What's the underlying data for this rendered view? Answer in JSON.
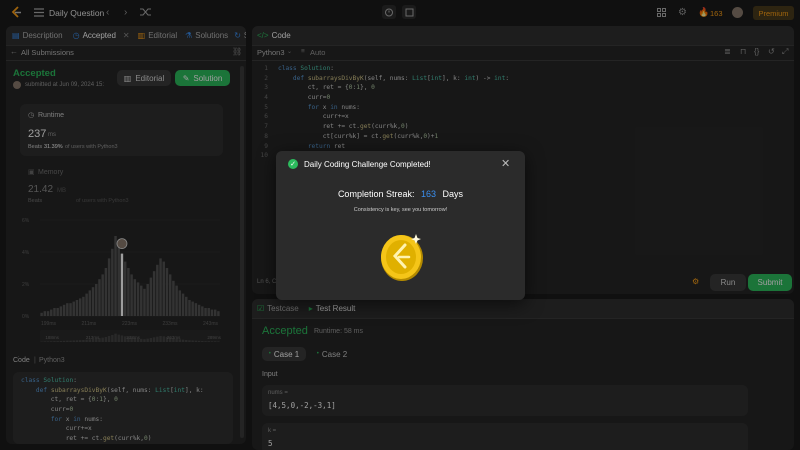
{
  "topbar": {
    "title": "Daily Question",
    "streak_count": "163",
    "premium_label": "Premium"
  },
  "left_panel": {
    "tabs": [
      "Description",
      "Accepted",
      "Editorial",
      "Solutions",
      "S"
    ],
    "back_link": "All Submissions",
    "status": "Accepted",
    "submitted_text": "submitted at Jun 09, 2024 15:",
    "editorial_button": "Editorial",
    "solution_button": "Solution",
    "runtime": {
      "label": "Runtime",
      "value": "237",
      "unit": "ms",
      "beats_label": "Beats",
      "beats_value": "31.39%",
      "beats_suffix": "of users with Python3"
    },
    "memory": {
      "label": "Memory",
      "value": "21.42",
      "unit": "MB",
      "beats_label": "Beats",
      "beats_value": "",
      "beats_suffix": "of users with Python3"
    },
    "code_label": "Code",
    "code_lang": "Python3"
  },
  "chart_data": {
    "type": "bar",
    "y_ticks": [
      "6%",
      "4%",
      "2%",
      "0%"
    ],
    "ylim": [
      0,
      6
    ],
    "x_ticks": [
      "199ms",
      "211ms",
      "223ms",
      "233ms",
      "243ms"
    ],
    "mini_x_ticks": [
      "188ms",
      "213ms",
      "238ms",
      "263ms",
      "289ms"
    ],
    "highlight_index": 25,
    "values": [
      0.2,
      0.3,
      0.3,
      0.4,
      0.5,
      0.5,
      0.6,
      0.7,
      0.8,
      0.8,
      0.9,
      1.0,
      1.1,
      1.2,
      1.4,
      1.6,
      1.8,
      2.0,
      2.3,
      2.6,
      3.0,
      3.6,
      4.2,
      5.0,
      4.4,
      3.9,
      3.4,
      3.0,
      2.6,
      2.3,
      2.1,
      1.9,
      1.7,
      2.0,
      2.4,
      2.8,
      3.2,
      3.6,
      3.4,
      3.0,
      2.6,
      2.2,
      1.9,
      1.6,
      1.4,
      1.2,
      1.0,
      0.9,
      0.8,
      0.7,
      0.6,
      0.5,
      0.5,
      0.4,
      0.4,
      0.3
    ]
  },
  "left_code": [
    "class Solution:",
    "    def subarraysDivByK(self, nums: List[int], k:",
    "        ct, ret = {0:1}, 0",
    "        curr=0",
    "        for x in nums:",
    "            curr+=x",
    "            ret += ct.get(curr%k,0)"
  ],
  "code_panel": {
    "title": "Code",
    "lang": "Python3",
    "auto": "Auto",
    "cursor_pos": "Ln 6, Co",
    "run_button": "Run",
    "submit_button": "Submit",
    "lines": [
      "class Solution:",
      "    def subarraysDivByK(self, nums: List[int], k: int) -> int:",
      "        ct, ret = {0:1}, 0",
      "        curr=0",
      "        for x in nums:",
      "            curr+=x",
      "            ret += ct.get(curr%k,0)",
      "            ct[curr%k] = ct.get(curr%k,0)+1",
      "        return ret",
      ""
    ]
  },
  "test_panel": {
    "tab_testcase": "Testcase",
    "tab_result": "Test Result",
    "status": "Accepted",
    "runtime": "Runtime: 58 ms",
    "cases": [
      "Case 1",
      "Case 2"
    ],
    "input_label": "Input",
    "nums_label": "nums =",
    "nums_value": "[4,5,0,-2,-3,1]",
    "k_label": "k =",
    "k_value": "5"
  },
  "modal": {
    "title": "Daily Coding Challenge Completed!",
    "streak_label": "Completion Streak:",
    "streak_value": "163",
    "streak_unit": "Days",
    "message": "Consistency is key, see you tomorrow!"
  },
  "colors": {
    "accent_green": "#2cbb5d",
    "accent_blue": "#3a8ff0",
    "accent_orange": "#ffa116"
  }
}
